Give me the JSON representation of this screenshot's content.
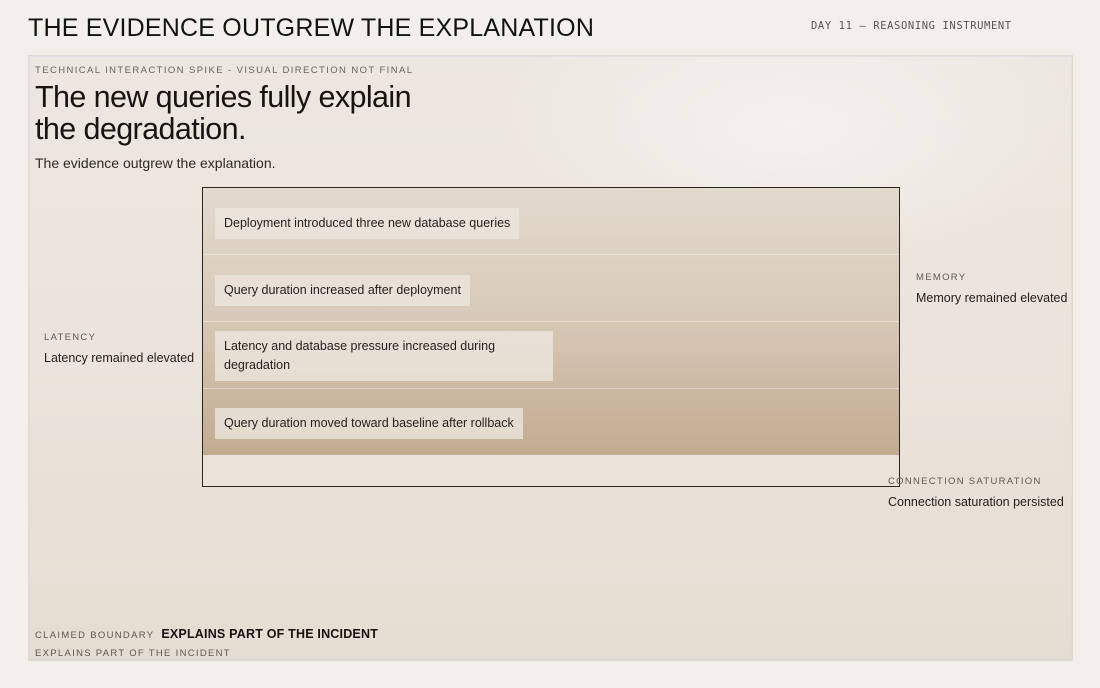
{
  "header": {
    "title": "THE EVIDENCE OUTGREW THE EXPLANATION",
    "day_label": "DAY 11 — REASONING INSTRUMENT"
  },
  "stage": {
    "spike_label": "TECHNICAL INTERACTION SPIKE - VISUAL DIRECTION NOT FINAL",
    "claim_heading": "The new queries fully explain the degradation.",
    "claim_sub": "The evidence outgrew the explanation.",
    "evidence_rows": [
      "Deployment introduced three new database queries",
      "Query duration increased after deployment",
      "Latency and database pressure increased during degradation",
      "Query duration moved toward baseline after rollback"
    ],
    "side_evidence": {
      "latency": {
        "label": "LATENCY",
        "value": "Latency remained elevated"
      },
      "memory": {
        "label": "MEMORY",
        "value": "Memory remained elevated"
      },
      "connection": {
        "label": "CONNECTION SATURATION",
        "value": "Connection saturation persisted"
      }
    },
    "boundary": {
      "label": "CLAIMED BOUNDARY",
      "value": "EXPLAINS PART OF THE INCIDENT",
      "echo": "EXPLAINS PART OF THE INCIDENT"
    }
  }
}
